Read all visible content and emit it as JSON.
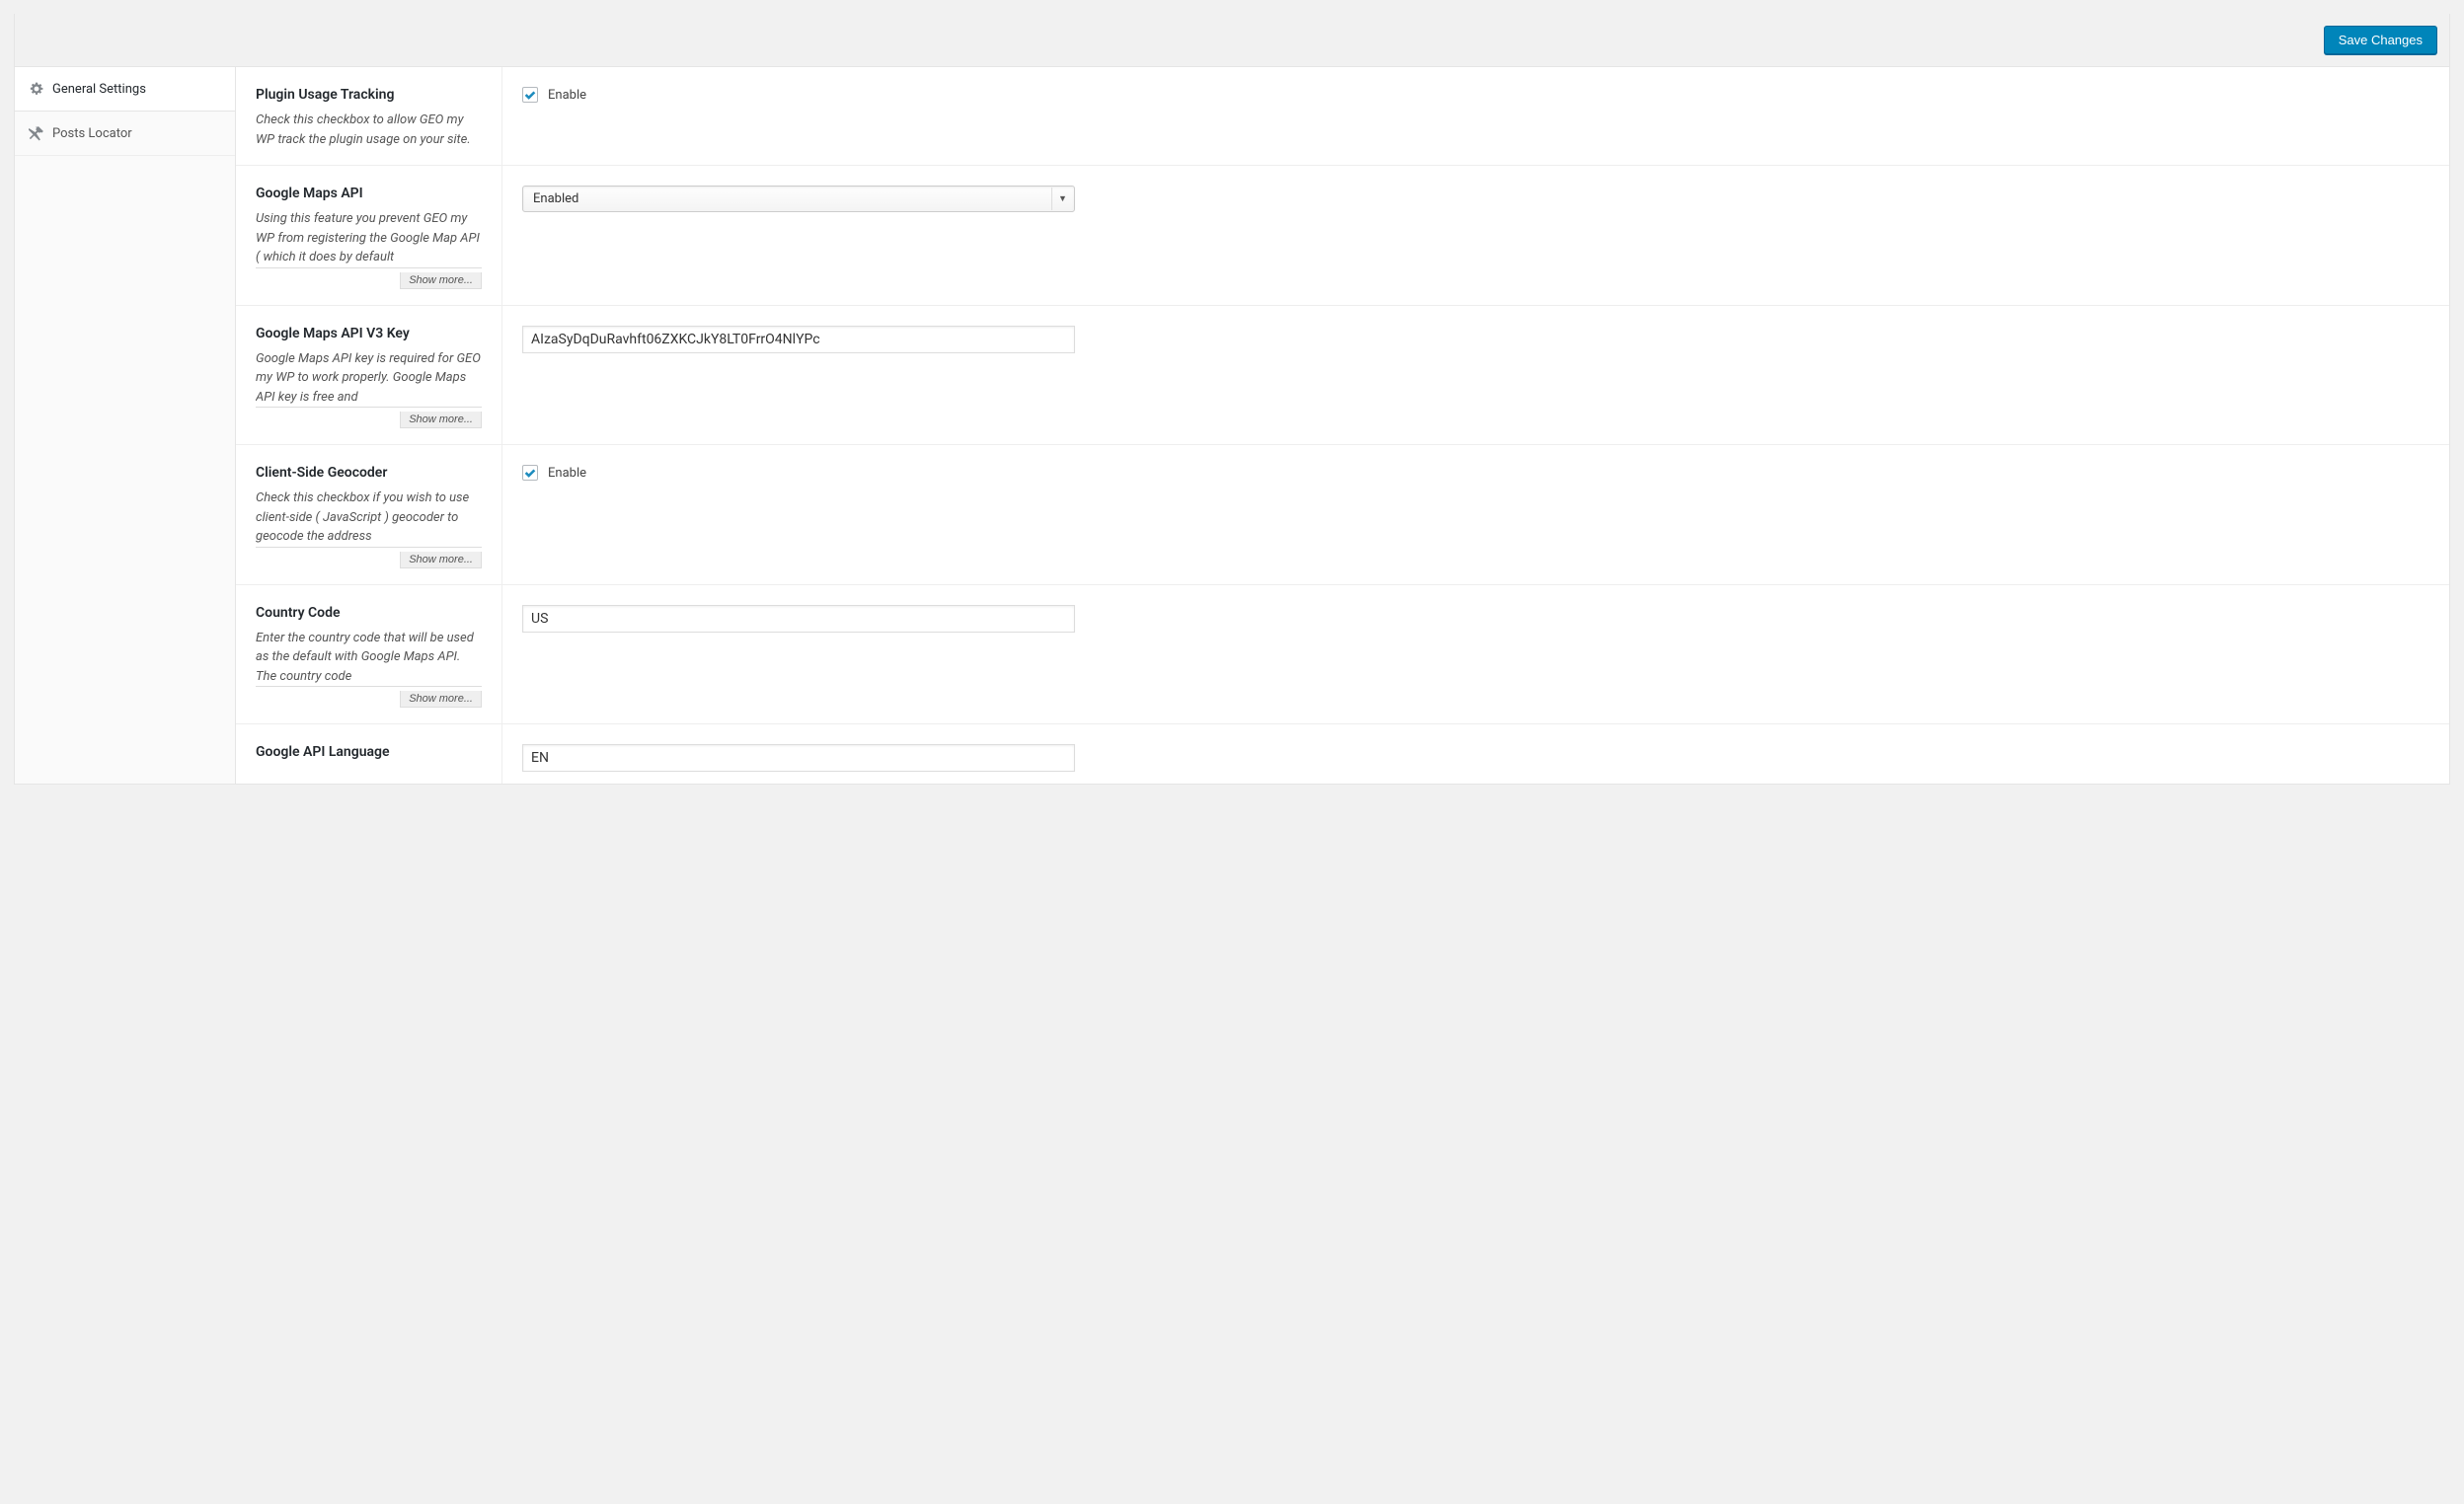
{
  "header": {
    "save_button_label": "Save Changes"
  },
  "sidebar": {
    "items": [
      {
        "label": "General Settings",
        "icon": "gear-icon",
        "active": true
      },
      {
        "label": "Posts Locator",
        "icon": "pin-icon",
        "active": false
      }
    ]
  },
  "settings": [
    {
      "key": "plugin_usage_tracking",
      "title": "Plugin Usage Tracking",
      "description": "Check this checkbox to allow GEO my WP track the plugin usage on your site.",
      "control": {
        "type": "checkbox",
        "label": "Enable",
        "checked": true
      },
      "show_more": false
    },
    {
      "key": "google_maps_api",
      "title": "Google Maps API",
      "description": "Using this feature you prevent GEO my WP from registering the Google Map API ( which it does by default",
      "control": {
        "type": "select",
        "value": "Enabled"
      },
      "show_more": true,
      "show_more_label": "Show more..."
    },
    {
      "key": "google_maps_api_v3_key",
      "title": "Google Maps API V3 Key",
      "description": "Google Maps API key is required for GEO my WP to work properly. Google Maps API key is free and",
      "control": {
        "type": "text",
        "value": "AIzaSyDqDuRavhft06ZXKCJkY8LT0FrrO4NlYPc"
      },
      "show_more": true,
      "show_more_label": "Show more..."
    },
    {
      "key": "client_side_geocoder",
      "title": "Client-Side Geocoder",
      "description": "Check this checkbox if you wish to use client-side ( JavaScript ) geocoder to geocode the address",
      "control": {
        "type": "checkbox",
        "label": "Enable",
        "checked": true
      },
      "show_more": true,
      "show_more_label": "Show more..."
    },
    {
      "key": "country_code",
      "title": "Country Code",
      "description": "Enter the country code that will be used as the default with Google Maps API. The country code",
      "control": {
        "type": "text",
        "value": "US"
      },
      "show_more": true,
      "show_more_label": "Show more..."
    },
    {
      "key": "google_api_language",
      "title": "Google API Language",
      "description": "",
      "control": {
        "type": "text",
        "value": "EN"
      },
      "show_more": false
    }
  ]
}
